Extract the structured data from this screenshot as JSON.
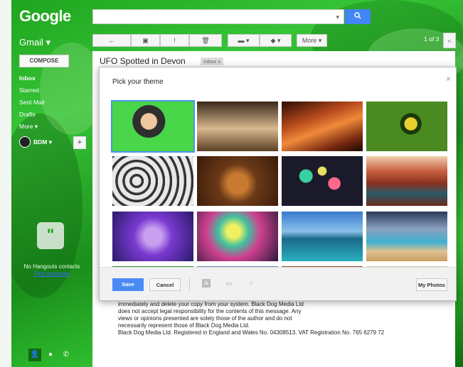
{
  "header": {
    "logo": "Google",
    "search_caret": "▾",
    "search_icon": "search-icon"
  },
  "sidebar": {
    "app_menu": "Gmail ▾",
    "compose_label": "COMPOSE",
    "items": [
      {
        "label": "Inbox",
        "active": true
      },
      {
        "label": "Starred"
      },
      {
        "label": "Sent Mail"
      },
      {
        "label": "Drafts"
      },
      {
        "label": "More ▾"
      }
    ],
    "account_label": "BDM ▾",
    "add_label": "+",
    "no_hangouts": "No Hangouts contacts",
    "find_someone": "Find someone",
    "bottom_icons": [
      "person-icon",
      "hangouts-icon",
      "phone-icon"
    ]
  },
  "toolbar": {
    "back": "←",
    "archive": "▣",
    "spam": "!",
    "delete": "🗑",
    "move": "▬ ▾",
    "labels": "◆ ▾",
    "more": "More ▾",
    "pager": "1 of 3",
    "pager_prev": "<"
  },
  "message": {
    "subject": "UFO Spotted in Devon",
    "label_chip": "Inbox x",
    "body_lines": [
      "immediately and delete your copy from your system. Black Dog Media Ltd",
      "does not accept legal responsibility for the contents of this message. Any",
      "views or opinions presented are solely those of the author and do not",
      "necessarily represent those of Black Dog Media Ltd.",
      "Black Dog Media Ltd. Registered in England and Wales No. 04308513. VAT Registration No. 765 6279 72"
    ]
  },
  "dialog": {
    "title": "Pick your theme",
    "close": "×",
    "themes": [
      {
        "name": "kid",
        "selected": true
      },
      {
        "name": "chess"
      },
      {
        "name": "canyon"
      },
      {
        "name": "caterpillar"
      },
      {
        "name": "pipes"
      },
      {
        "name": "leaves"
      },
      {
        "name": "bokeh"
      },
      {
        "name": "river-canyon"
      },
      {
        "name": "jellyfish"
      },
      {
        "name": "bubble"
      },
      {
        "name": "lake"
      },
      {
        "name": "beach"
      },
      {
        "name": "row4-1"
      },
      {
        "name": "row4-2"
      },
      {
        "name": "row4-3"
      },
      {
        "name": "row4-4"
      }
    ],
    "save_label": "Save",
    "cancel_label": "Cancel",
    "text_icon": "A",
    "myphotos_label": "My Photos"
  }
}
